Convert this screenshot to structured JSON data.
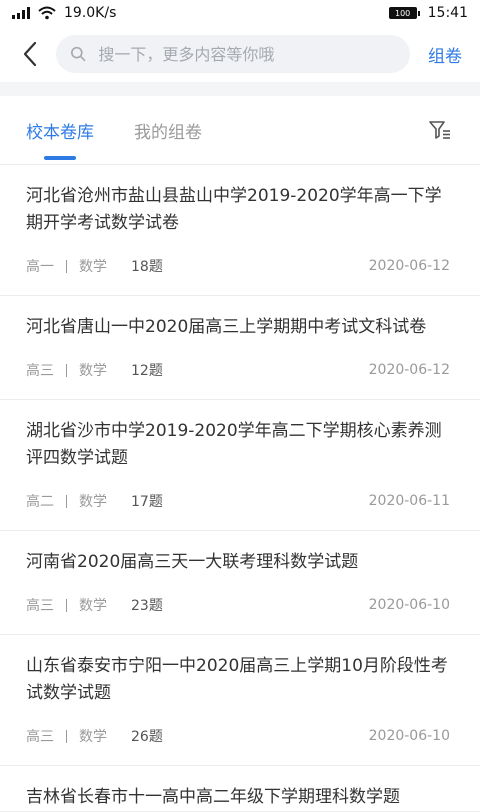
{
  "status_bar": {
    "network_speed": "19.0K/s",
    "battery": "100",
    "time": "15:41"
  },
  "search": {
    "placeholder": "搜一下，更多内容等你哦"
  },
  "header": {
    "compose_label": "组卷"
  },
  "tabs": [
    {
      "label": "校本卷库",
      "active": true
    },
    {
      "label": "我的组卷",
      "active": false
    }
  ],
  "items": [
    {
      "title": "河北省沧州市盐山县盐山中学2019-2020学年高一下学期开学考试数学试卷",
      "grade": "高一",
      "subject": "数学",
      "count": "18题",
      "date": "2020-06-12"
    },
    {
      "title": "河北省唐山一中2020届高三上学期期中考试文科试卷",
      "grade": "高三",
      "subject": "数学",
      "count": "12题",
      "date": "2020-06-12"
    },
    {
      "title": "湖北省沙市中学2019-2020学年高二下学期核心素养测评四数学试题",
      "grade": "高二",
      "subject": "数学",
      "count": "17题",
      "date": "2020-06-11"
    },
    {
      "title": "河南省2020届高三天一大联考理科数学试题",
      "grade": "高三",
      "subject": "数学",
      "count": "23题",
      "date": "2020-06-10"
    },
    {
      "title": "山东省泰安市宁阳一中2020届高三上学期10月阶段性考试数学试题",
      "grade": "高三",
      "subject": "数学",
      "count": "26题",
      "date": "2020-06-10"
    },
    {
      "title": "吉林省长春市十一高中高二年级下学期理科数学题",
      "grade": "",
      "subject": "",
      "count": "",
      "date": ""
    }
  ],
  "colors": {
    "accent": "#2e7be5",
    "muted": "#9a9a9a",
    "search_bg": "#f0f2f5"
  }
}
